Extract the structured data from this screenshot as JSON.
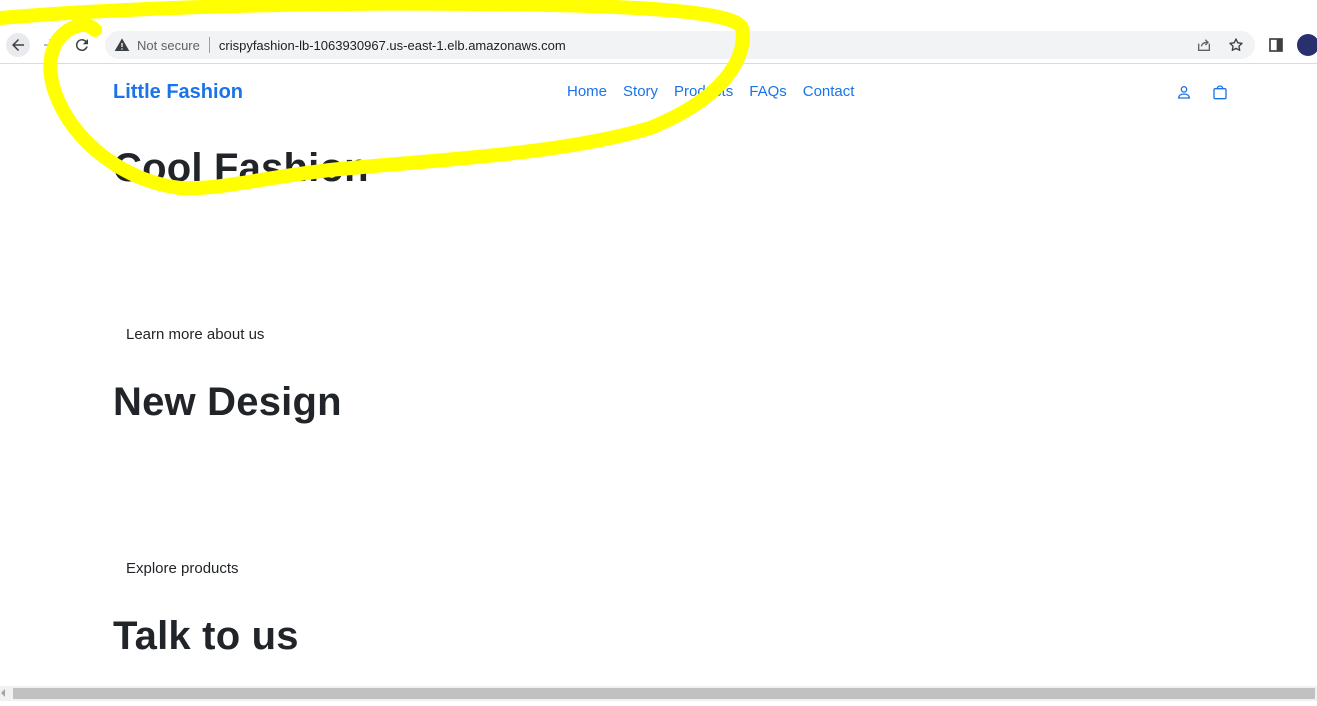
{
  "browser": {
    "security_label": "Not secure",
    "url": "crispyfashion-lb-1063930967.us-east-1.elb.amazonaws.com",
    "icons": [
      "back-icon",
      "forward-icon",
      "reload-icon",
      "warning-icon",
      "share-icon",
      "star-icon",
      "side-panel-icon"
    ]
  },
  "site": {
    "brand": "Little Fashion",
    "nav": [
      {
        "label": "Home"
      },
      {
        "label": "Story"
      },
      {
        "label": "Products"
      },
      {
        "label": "FAQs"
      },
      {
        "label": "Contact"
      }
    ],
    "icons": [
      "user-icon",
      "shopping-bag-icon"
    ],
    "accent_color": "#1a73e8"
  },
  "main": {
    "sections": [
      {
        "title": "Cool Fashion",
        "link": ""
      },
      {
        "title": "New Design",
        "link": "Learn more about us"
      },
      {
        "title": "Talk to us",
        "link": "Explore products"
      }
    ]
  },
  "annotation": {
    "color": "#ffff00"
  }
}
